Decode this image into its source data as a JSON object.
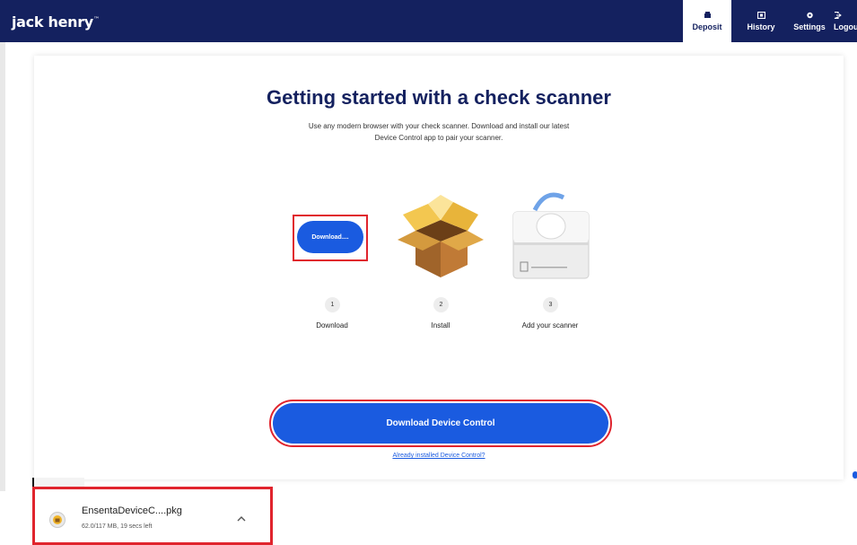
{
  "header": {
    "logo": "jack henry",
    "logo_mark": "™",
    "nav": [
      {
        "label": "Deposit",
        "icon": "deposit-icon",
        "active": true
      },
      {
        "label": "History",
        "icon": "history-icon",
        "active": false
      },
      {
        "label": "Settings",
        "icon": "settings-icon",
        "active": false
      },
      {
        "label": "Logou",
        "icon": "logout-icon",
        "active": false
      }
    ]
  },
  "main": {
    "title": "Getting started with a check scanner",
    "subtitle_line1": "Use any modern browser with your check scanner. Download and install our latest",
    "subtitle_line2": "Device Control app to pair your scanner.",
    "download_pill": "Download....",
    "steps": [
      {
        "number": "1",
        "label": "Download"
      },
      {
        "number": "2",
        "label": "Install"
      },
      {
        "number": "3",
        "label": "Add your scanner"
      }
    ],
    "primary_button": "Download Device Control",
    "link": "Already installed Device Control?"
  },
  "download_bar": {
    "file_name": "EnsentaDeviceC....pkg",
    "status": "62.0/117 MB, 19 secs left"
  },
  "colors": {
    "navy": "#14215f",
    "accent_blue": "#1a5be0",
    "highlight_red": "#e0242d"
  }
}
